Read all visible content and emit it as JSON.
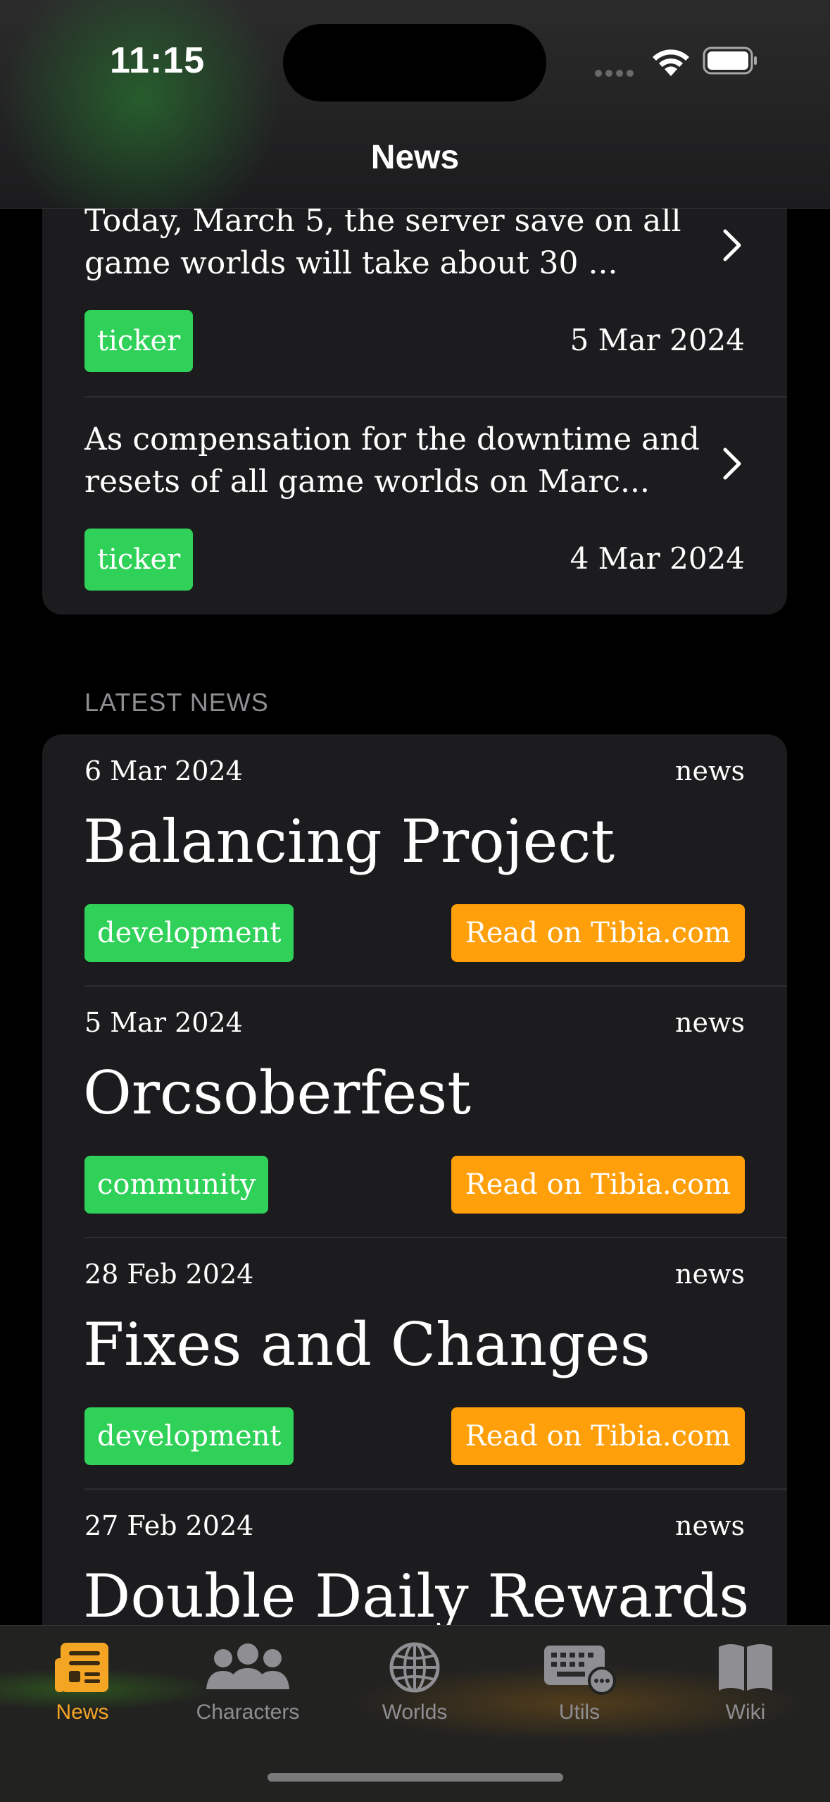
{
  "status_bar": {
    "time": "11:15"
  },
  "nav": {
    "title": "News"
  },
  "ticker_items": [
    {
      "text": "Today, March 5, the server save on all game worlds will take about 30 ...",
      "tag": "ticker",
      "date": "5 Mar 2024"
    },
    {
      "text": "As compensation for the downtime and resets of all game worlds on Marc...",
      "tag": "ticker",
      "date": "4 Mar 2024"
    }
  ],
  "latest_news": {
    "section_label": "LATEST NEWS",
    "items": [
      {
        "date": "6 Mar 2024",
        "category": "news",
        "title": "Balancing Project",
        "tag": "development",
        "action": "Read on Tibia.com"
      },
      {
        "date": "5 Mar 2024",
        "category": "news",
        "title": "Orcsoberfest",
        "tag": "community",
        "action": "Read on Tibia.com"
      },
      {
        "date": "28 Feb 2024",
        "category": "news",
        "title": "Fixes and Changes",
        "tag": "development",
        "action": "Read on Tibia.com"
      },
      {
        "date": "27 Feb 2024",
        "category": "news",
        "title": "Double Daily Rewards"
      }
    ]
  },
  "tabbar": {
    "items": [
      {
        "label": "News",
        "icon": "newspaper-icon",
        "active": true
      },
      {
        "label": "Characters",
        "icon": "people-icon"
      },
      {
        "label": "Worlds",
        "icon": "globe-icon"
      },
      {
        "label": "Utils",
        "icon": "keyboard-icon"
      },
      {
        "label": "Wiki",
        "icon": "book-icon"
      }
    ]
  },
  "colors": {
    "tag_green": "#30d158",
    "action_orange": "#ff9f0a",
    "active_tab": "#f5a524",
    "card_bg": "#1c1c1e"
  }
}
